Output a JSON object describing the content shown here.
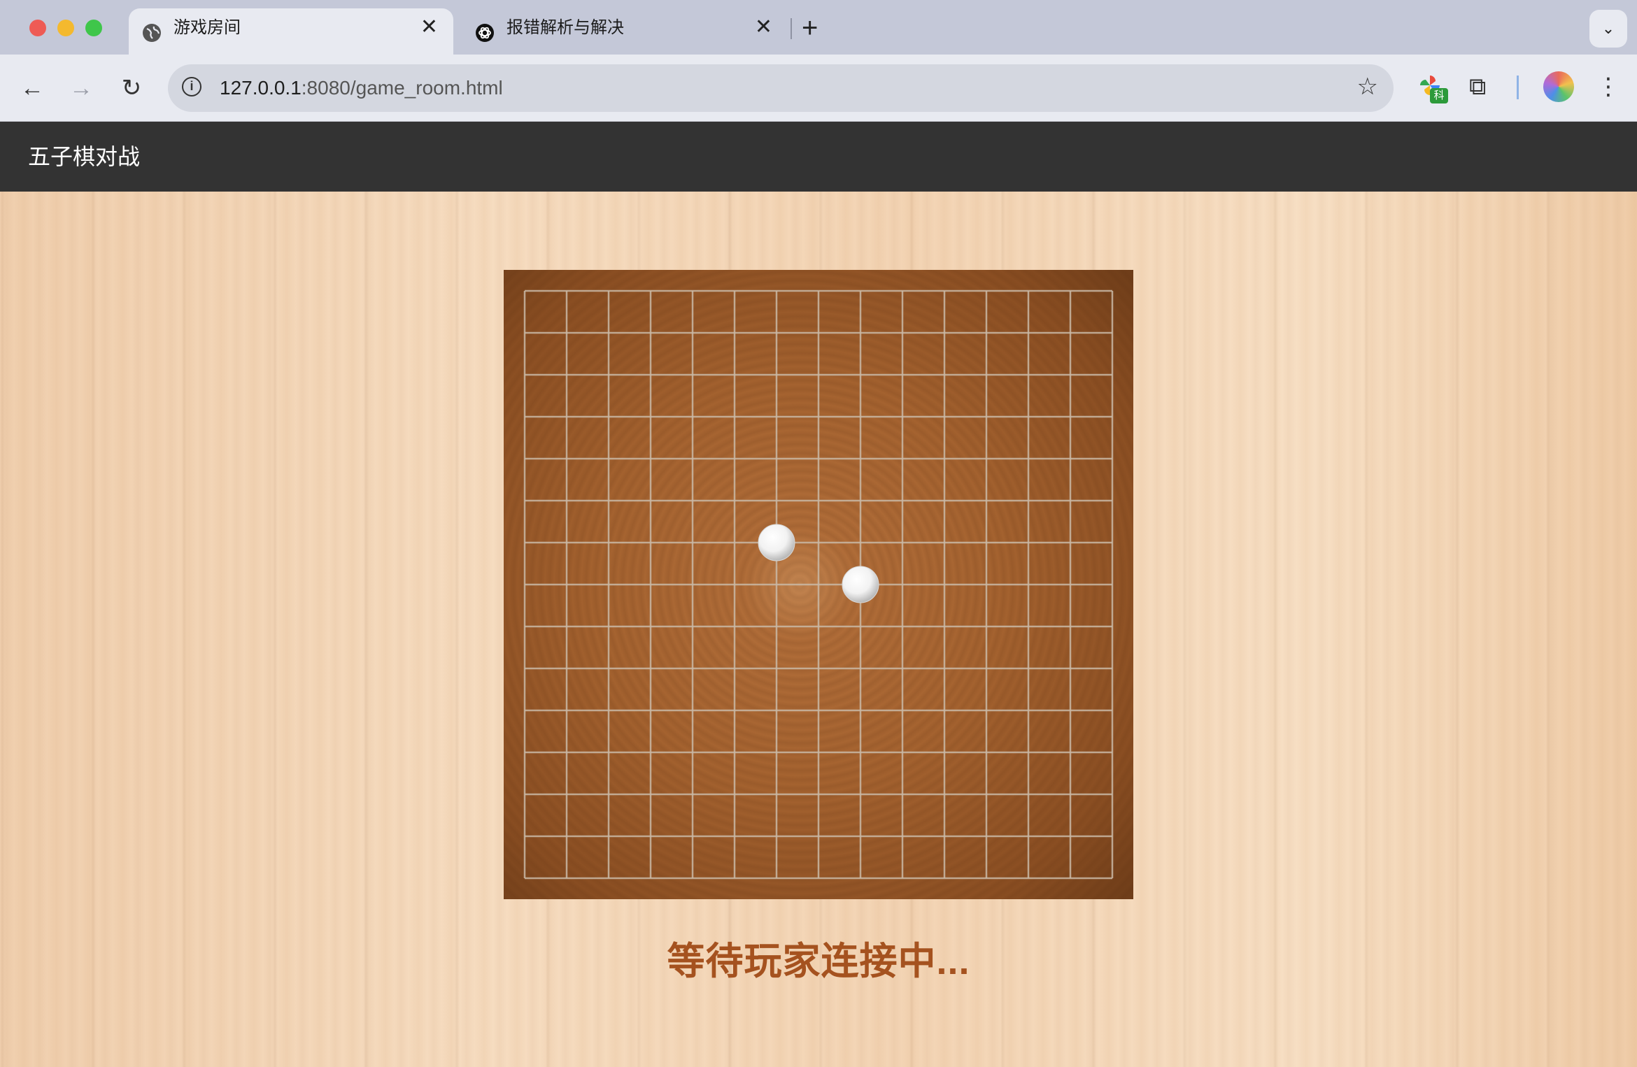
{
  "browser": {
    "tabs": [
      {
        "title": "游戏房间",
        "icon": "globe-icon",
        "active": true
      },
      {
        "title": "报错解析与解决",
        "icon": "openai-icon",
        "active": false
      }
    ],
    "url_host": "127.0.0.1",
    "url_rest": ":8080/game_room.html",
    "extension_badge": "科"
  },
  "page": {
    "app_title": "五子棋对战",
    "status_text": "等待玩家连接中..."
  },
  "board": {
    "size": 15,
    "colors": {
      "line": "#c9b8a6",
      "stone_white": "#f2f2f2"
    },
    "stones": [
      {
        "row": 6,
        "col": 6,
        "color": "white"
      },
      {
        "row": 7,
        "col": 8,
        "color": "white"
      }
    ]
  }
}
